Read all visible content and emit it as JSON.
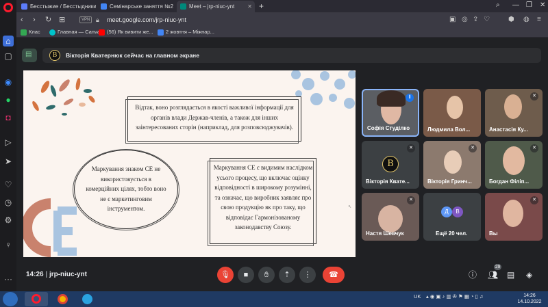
{
  "browser": {
    "tabs": [
      {
        "title": "Бесстыжие / Бесстыдники",
        "favicon_color": "#5c7cfa",
        "active": false
      },
      {
        "title": "Семінарське заняття №2",
        "favicon_color": "#4285f4",
        "active": false
      },
      {
        "title": "Meet – jrp-niuc-ynt",
        "favicon_color": "#00897b",
        "active": true
      }
    ],
    "new_tab": "+",
    "vpn_label": "VPN",
    "url": "meet.google.com/jrp-niuc-ynt",
    "bookmarks": [
      {
        "label": "Клас",
        "favicon_color": "#34a853"
      },
      {
        "label": "Главная — Canva",
        "favicon_color": "#00c4cc"
      },
      {
        "label": "(56) Як вивити же...",
        "favicon_color": "#ff0000"
      },
      {
        "label": "2 жовтня – Міжнар...",
        "favicon_color": "#4285f4"
      }
    ]
  },
  "meet": {
    "presenter_initial": "В",
    "presenter_banner": "Вікторія Кватернюк сейчас на главном экране",
    "slide": {
      "box_top": "Відтак, воно розглядається в якості важливої інформації для органів влади Держав-членів, а також для інших заінтересованих сторін (наприклад, для розповсюджувачів).",
      "box_left": "Маркування знаком СЕ не використовується в комерційних цілях, тобто воно не є маркетинговим інструментом.",
      "box_right": "Маркування СЕ є видимим наслідком усього процесу, що включає оцінку відповідності в широкому розумінні, та означає, що виробник заявляє про свою продукцію як про таку, що відповідає Гармонізованому законодавству Союзу.",
      "logo_text": "CE",
      "colors": {
        "accent_orange": "#d4733f",
        "accent_blue": "#a9c4e0",
        "accent_teal": "#2f6b6b",
        "accent_pink": "#c9826d"
      }
    },
    "participants": [
      {
        "name": "Софія Студілко",
        "active": true
      },
      {
        "name": "Людмила Вол...",
        "active": false
      },
      {
        "name": "Анастасія Ку...",
        "active": false
      },
      {
        "name": "Вікторія Квате...",
        "active": false
      },
      {
        "name": "Вікторія Гринч...",
        "active": false
      },
      {
        "name": "Богдан Філіп...",
        "active": false
      },
      {
        "name": "Настя Шевчук",
        "active": false
      },
      {
        "name": "Ещё 20 чел.",
        "active": false,
        "avatars": [
          "Д",
          "В"
        ]
      },
      {
        "name": "Вы",
        "active": false
      }
    ],
    "meeting_time": "14:26",
    "meeting_code": "jrp-niuc-ynt",
    "people_count": "29"
  },
  "taskbar": {
    "lang": "UK",
    "time": "14:26",
    "date": "14.10.2022"
  }
}
